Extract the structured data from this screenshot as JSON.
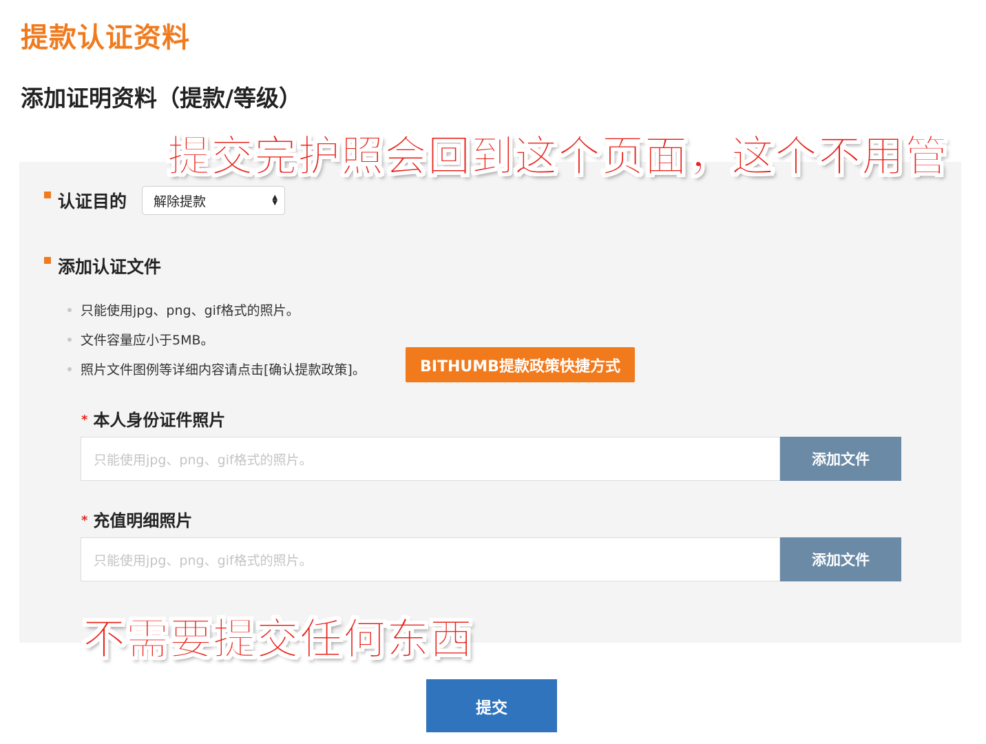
{
  "header": {
    "title": "提款认证资料",
    "section_title": "添加证明资料（提款/等级）"
  },
  "form": {
    "purpose": {
      "label": "认证目的",
      "selected": "解除提款"
    },
    "files": {
      "label": "添加认证文件",
      "notes": [
        "只能使用jpg、png、gif格式的照片。",
        "文件容量应小于5MB。",
        "照片文件图例等详细内容请点击[确认提款政策]。"
      ],
      "policy_button": "BITHUMB提款政策快捷方式"
    },
    "uploads": [
      {
        "required_mark": "*",
        "label": "本人身份证件照片",
        "placeholder": "只能使用jpg、png、gif格式的照片。",
        "button": "添加文件"
      },
      {
        "required_mark": "*",
        "label": "充值明细照片",
        "placeholder": "只能使用jpg、png、gif格式的照片。",
        "button": "添加文件"
      }
    ],
    "submit": "提交"
  },
  "annotations": {
    "top": "提交完护照会回到这个页面，这个不用管",
    "bottom": "不需要提交任何东西"
  },
  "colors": {
    "brand_orange": "#f07b1f",
    "annotation_red": "#e8231b",
    "upload_button": "#6b8aa6",
    "submit_blue": "#2f74bd",
    "panel_bg": "#f3f4f3"
  }
}
